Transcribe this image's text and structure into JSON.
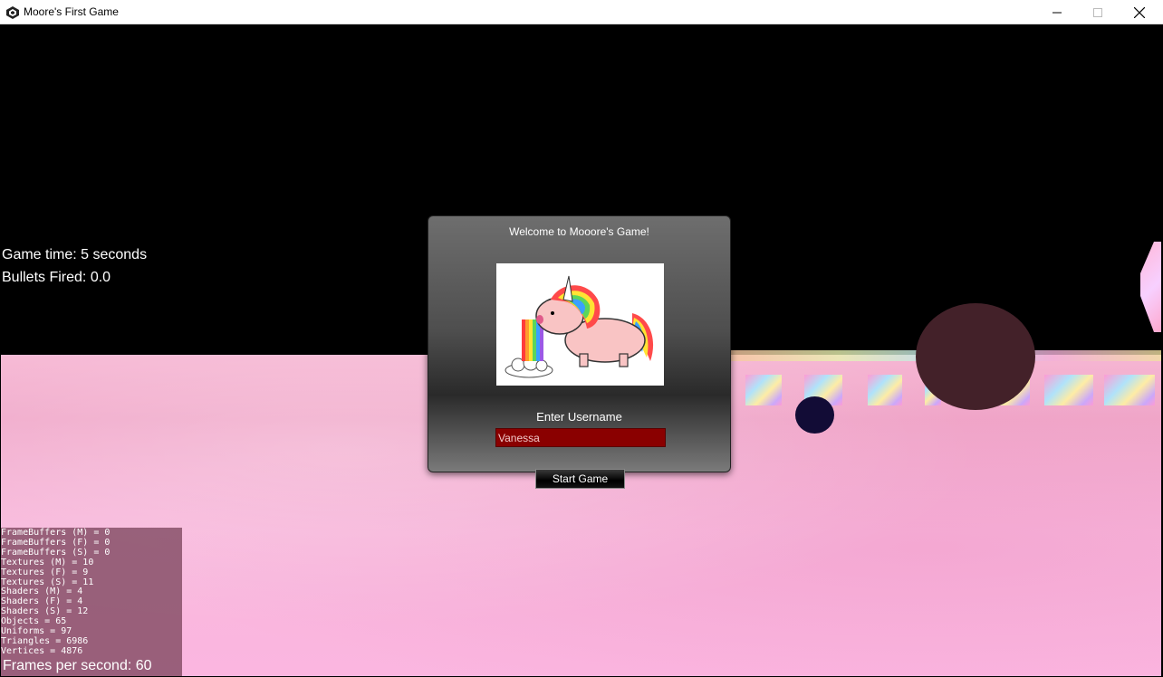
{
  "window": {
    "title": "Moore's First Game",
    "minimize_glyph": "—",
    "maximize_glyph": "☐",
    "close_glyph": "✕"
  },
  "hud": {
    "game_time": "Game time: 5 seconds",
    "bullets_fired": "Bullets Fired: 0.0",
    "fps": "Frames per second: 60"
  },
  "stats": [
    "FrameBuffers (M) = 0",
    "FrameBuffers (F) = 0",
    "FrameBuffers (S) = 0",
    "Textures (M) = 10",
    "Textures (F) = 9",
    "Textures (S) = 11",
    "Shaders (M) = 4",
    "Shaders (F) = 4",
    "Shaders (S) = 12",
    "Objects = 65",
    "Uniforms = 97",
    "Triangles = 6986",
    "Vertices = 4876"
  ],
  "dialog": {
    "title": "Welcome to Mooore's Game!",
    "username_label": "Enter Username",
    "username_value": "Vanessa",
    "start_button": "Start Game"
  },
  "colors": {
    "floor": "#f0a7c9",
    "big_sphere": "#432129",
    "small_sphere": "#120c36",
    "input_bg": "#8a0000"
  }
}
